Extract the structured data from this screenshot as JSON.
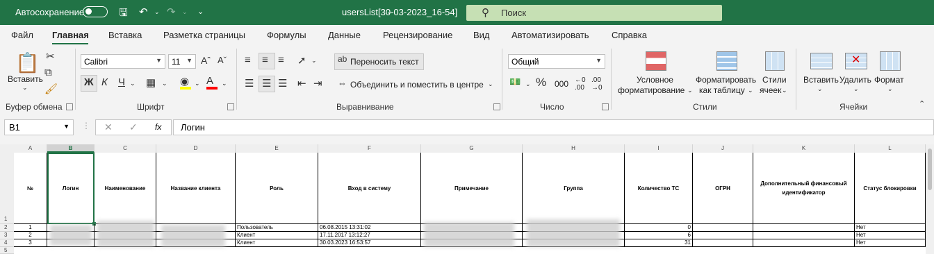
{
  "titlebar": {
    "autosave_label": "Автосохранение",
    "document_title": "usersList[30-03-2023_16-54]",
    "search_placeholder": "Поиск"
  },
  "menu": [
    "Файл",
    "Главная",
    "Вставка",
    "Разметка страницы",
    "Формулы",
    "Данные",
    "Рецензирование",
    "Вид",
    "Автоматизировать",
    "Справка"
  ],
  "ribbon": {
    "clipboard": {
      "paste": "Вставить",
      "group": "Буфер обмена"
    },
    "font": {
      "name": "Calibri",
      "size": "11",
      "bold": "Ж",
      "italic": "К",
      "underline": "Ч",
      "group": "Шрифт"
    },
    "alignment": {
      "wrap": "Переносить текст",
      "merge": "Объединить и поместить в центре",
      "group": "Выравнивание"
    },
    "number": {
      "format": "Общий",
      "percent": "%",
      "thousands": "000",
      "group": "Число"
    },
    "styles": {
      "conditional1": "Условное",
      "conditional2": "форматирование",
      "table1": "Форматировать",
      "table2": "как таблицу",
      "cell1": "Стили",
      "cell2": "ячеек",
      "group": "Стили"
    },
    "cells": {
      "insert": "Вставить",
      "delete": "Удалить",
      "format": "Формат",
      "group": "Ячейки"
    }
  },
  "formula_bar": {
    "name_box": "B1",
    "fx": "fx",
    "content": "Логин"
  },
  "sheet": {
    "columns": [
      "A",
      "B",
      "C",
      "D",
      "E",
      "F",
      "G",
      "H",
      "I",
      "J",
      "K",
      "L"
    ],
    "rows": [
      "1",
      "2",
      "3",
      "4",
      "5"
    ],
    "headers": [
      "№",
      "Логин",
      "Наименование",
      "Название клиента",
      "Роль",
      "Вход в систему",
      "Примечание",
      "Группа",
      "Количество ТС",
      "ОГРН",
      "Дополнительный финансовый идентификатор",
      "Статус блокировки"
    ],
    "data": [
      {
        "n": "1",
        "role": "Пользователь",
        "login_time": "06.08.2015 13:31:02",
        "count": "0",
        "status": "Нет"
      },
      {
        "n": "2",
        "role": "Клиент",
        "login_time": "17.11.2017 13:12:27",
        "count": "6",
        "status": "Нет"
      },
      {
        "n": "3",
        "role": "Клиент",
        "login_time": "30.03.2023 16:53:57",
        "count": "31",
        "status": "Нет"
      }
    ]
  }
}
